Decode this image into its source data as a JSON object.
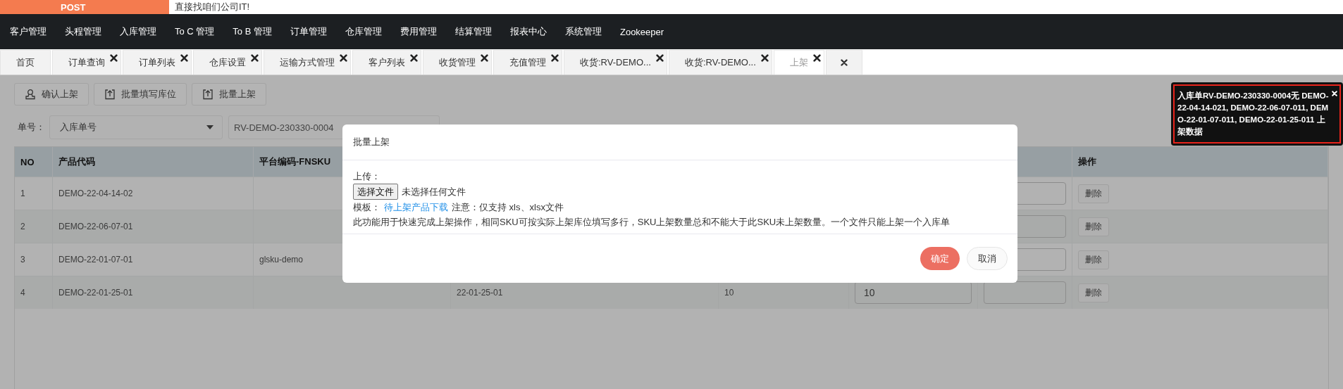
{
  "header": {
    "logo_text": "POST",
    "slogan": "直接找咱们公司IT!"
  },
  "nav": [
    "客户管理",
    "头程管理",
    "入库管理",
    "To C 管理",
    "To B 管理",
    "订单管理",
    "仓库管理",
    "费用管理",
    "结算管理",
    "报表中心",
    "系统管理",
    "Zookeeper"
  ],
  "tabs": [
    {
      "kind": "page",
      "label": "首页",
      "closable": false,
      "selected": false
    },
    {
      "kind": "page",
      "label": "订单查询",
      "closable": true,
      "selected": false
    },
    {
      "kind": "page",
      "label": "订单列表",
      "closable": true,
      "selected": false
    },
    {
      "kind": "page",
      "label": "仓库设置",
      "closable": true,
      "selected": false
    },
    {
      "kind": "page",
      "label": "运输方式管理",
      "closable": true,
      "selected": false
    },
    {
      "kind": "page",
      "label": "客户列表",
      "closable": true,
      "selected": false
    },
    {
      "kind": "page",
      "label": "收货管理",
      "closable": true,
      "selected": false
    },
    {
      "kind": "page",
      "label": "充值管理",
      "closable": true,
      "selected": false
    },
    {
      "kind": "page",
      "label": "收货:RV-DEMO...",
      "closable": true,
      "selected": false
    },
    {
      "kind": "page",
      "label": "收货:RV-DEMO...",
      "closable": true,
      "selected": false
    },
    {
      "kind": "page",
      "label": "上架",
      "closable": true,
      "selected": true
    },
    {
      "kind": "close_all",
      "selected": false
    }
  ],
  "toolbar": [
    {
      "label": "确认上架",
      "kind": "confirm"
    },
    {
      "label": "批量填写库位",
      "kind": "upload"
    },
    {
      "label": "批量上架",
      "kind": "upload"
    }
  ],
  "filter": {
    "label": "单号：",
    "type_select": "入库单号",
    "order_input": "RV-DEMO-230330-0004"
  },
  "table": {
    "columns": [
      "NO",
      "产品代码",
      "平台编码-FNSKU"
    ],
    "action_column": "操作",
    "rows": [
      {
        "no": "1",
        "product_code": "DEMO-22-04-14-02",
        "action": "删除"
      },
      {
        "no": "2",
        "product_code": "DEMO-22-06-07-01",
        "action": "删除"
      },
      {
        "no": "3",
        "product_code": "DEMO-22-01-07-01",
        "fnsku": "glsku-demo",
        "action": "删除"
      },
      {
        "no": "4",
        "product_code": "DEMO-22-01-25-01",
        "column_4": "22-01-25-01",
        "column_5": "10",
        "column_6": "10",
        "action": "删除"
      }
    ]
  },
  "dialog": {
    "title": "批量上架",
    "upload_label": "上传：",
    "file_button": "选择文件",
    "file_status": "未选择任何文件",
    "template_label": "模板：",
    "template_link": "待上架产品下载",
    "note": "注意：仅支持 xls、xlsx文件",
    "description": "此功能用于快速完成上架操作，相同SKU可按实际上架库位填写多行，SKU上架数量总和不能大于此SKU未上架数量。一个文件只能上架一个入库单",
    "confirm": "确定",
    "cancel": "取消"
  },
  "tooltip": {
    "message": "入库单RV-DEMO-230330-0004无 DEMO-22-04-14-021, DEMO-22-06-07-011, DEMO-22-01-07-011, DEMO-22-01-25-011 上架数据"
  }
}
